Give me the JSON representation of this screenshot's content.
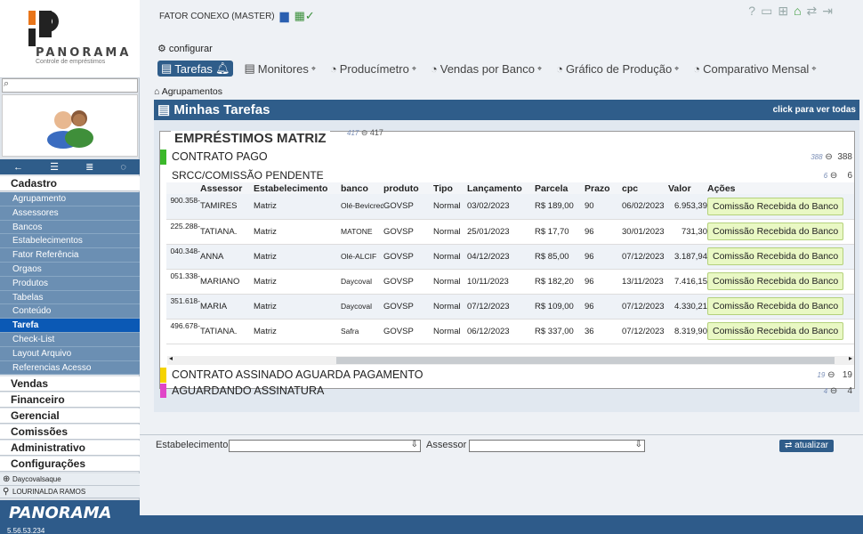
{
  "header": {
    "master": "FATOR CONEXO (MASTER)"
  },
  "sidebar": {
    "logo_name": "PANORAMA",
    "logo_sub": "Controle de empréstimos",
    "sections_top": [
      "Cadastro"
    ],
    "items": [
      "Agrupamento",
      "Assessores",
      "Bancos",
      "Estabelecimentos",
      "Fator Referência",
      "Orgaos",
      "Produtos",
      "Tabelas",
      "Conteúdo",
      "Tarefa",
      "Check-List",
      "Layout Arquivo",
      "Referencias Acesso"
    ],
    "sections": [
      "Vendas",
      "Financeiro",
      "Gerencial",
      "Comissões",
      "Administrativo",
      "Configurações"
    ],
    "user_company": "Daycovalsaque",
    "user_name": "LOURINALDA RAMOS",
    "footer_logo": "PANORAMA",
    "footer_version": "5.56.53.234"
  },
  "main": {
    "configurar": "configurar",
    "tabs": [
      "Tarefas",
      "Monitores",
      "Producímetro",
      "Vendas por Banco",
      "Gráfico de Produção",
      "Comparativo Mensal"
    ],
    "agrupamentos": "Agrupamentos",
    "title": "Minhas Tarefas",
    "click_all": "click para ver todas"
  },
  "emp": {
    "title": "EMPRÉSTIMOS MATRIZ",
    "count_a": "417",
    "count_b": "417"
  },
  "groups": [
    {
      "label": "CONTRATO PAGO",
      "a": "388",
      "b": "388",
      "color": "#3bb82a"
    },
    {
      "label": "CONTRATO ASSINADO AGUARDA PAGAMENTO",
      "a": "19",
      "b": "19",
      "color": "#f5d300"
    },
    {
      "label": "AGUARDANDO ASSINATURA",
      "a": "4",
      "b": "4",
      "color": "#e045c8"
    }
  ],
  "subgroup": {
    "label": "SRCC/COMISSÃO PENDENTE",
    "a": "6",
    "b": "6"
  },
  "table": {
    "headers": [
      "",
      "Assessor",
      "Estabelecimento",
      "banco",
      "produto",
      "Tipo",
      "Lançamento",
      "Parcela",
      "Prazo",
      "cpc",
      "Valor",
      "Ações"
    ],
    "rows": [
      {
        "cpf": "900.358-",
        "assessor": "TAMIRES",
        "estab": "Matriz",
        "banco": "Olé-Bevicred",
        "produto": "GOVSP",
        "tipo": "Normal",
        "lanc": "03/02/2023",
        "parcela": "R$ 189,00",
        "prazo": "90",
        "cpc": "06/02/2023",
        "valor": "6.953,39",
        "acao": "Comissão Recebida do Banco"
      },
      {
        "cpf": "225.288-",
        "assessor": "TATIANA.",
        "estab": "Matriz",
        "banco": "MATONE",
        "produto": "GOVSP",
        "tipo": "Normal",
        "lanc": "25/01/2023",
        "parcela": "R$ 17,70",
        "prazo": "96",
        "cpc": "30/01/2023",
        "valor": "731,30",
        "acao": "Comissão Recebida do Banco"
      },
      {
        "cpf": "040.348-",
        "assessor": "ANNA",
        "estab": "Matriz",
        "banco": "Olé-ALCIF",
        "produto": "GOVSP",
        "tipo": "Normal",
        "lanc": "04/12/2023",
        "parcela": "R$ 85,00",
        "prazo": "96",
        "cpc": "07/12/2023",
        "valor": "3.187,94",
        "acao": "Comissão Recebida do Banco"
      },
      {
        "cpf": "051.338-",
        "assessor": "MARIANO",
        "estab": "Matriz",
        "banco": "Daycoval",
        "produto": "GOVSP",
        "tipo": "Normal",
        "lanc": "10/11/2023",
        "parcela": "R$ 182,20",
        "prazo": "96",
        "cpc": "13/11/2023",
        "valor": "7.416,15",
        "acao": "Comissão Recebida do Banco"
      },
      {
        "cpf": "351.618-",
        "assessor": "MARIA",
        "estab": "Matriz",
        "banco": "Daycoval",
        "produto": "GOVSP",
        "tipo": "Normal",
        "lanc": "07/12/2023",
        "parcela": "R$ 109,00",
        "prazo": "96",
        "cpc": "07/12/2023",
        "valor": "4.330,21",
        "acao": "Comissão Recebida do Banco"
      },
      {
        "cpf": "496.678-",
        "assessor": "TATIANA.",
        "estab": "Matriz",
        "banco": "Safra",
        "produto": "GOVSP",
        "tipo": "Normal",
        "lanc": "06/12/2023",
        "parcela": "R$ 337,00",
        "prazo": "36",
        "cpc": "07/12/2023",
        "valor": "8.319,90",
        "acao": "Comissão Recebida do Banco"
      }
    ]
  },
  "filters": {
    "estab_label": "Estabelecimento",
    "assessor_label": "Assessor",
    "atualizar": "atualizar"
  }
}
